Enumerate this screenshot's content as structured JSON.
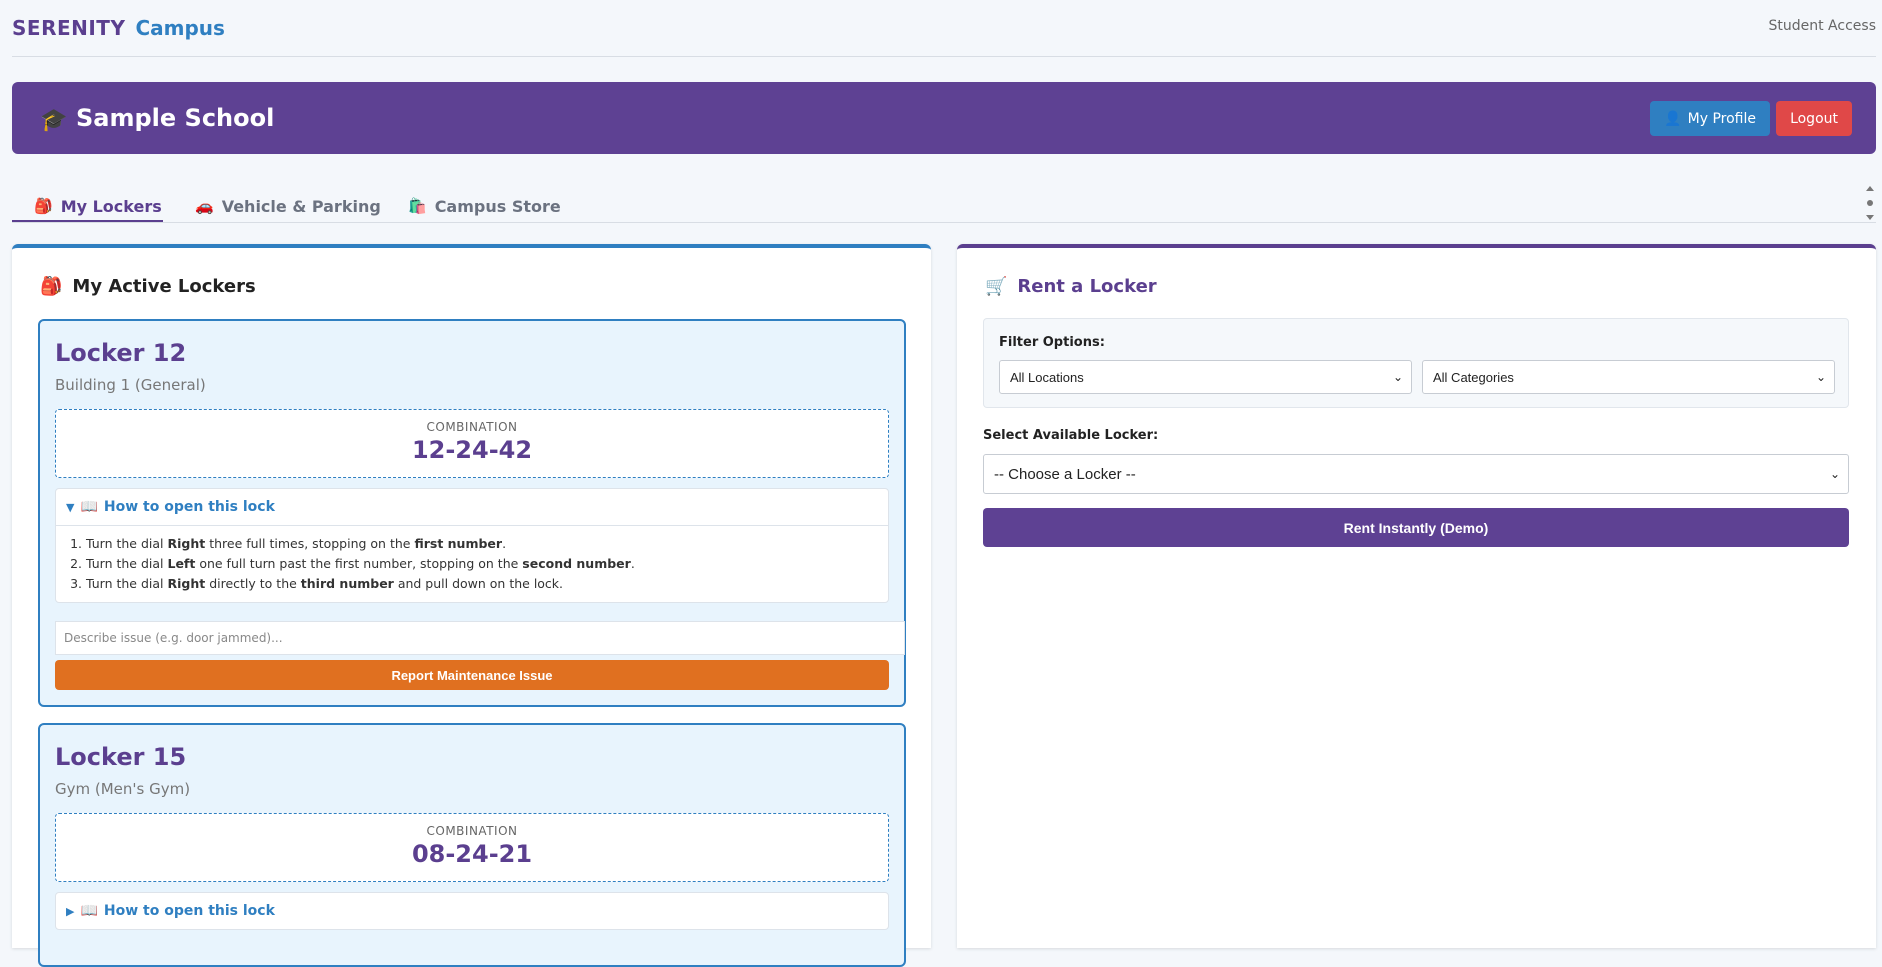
{
  "topbar": {
    "brand_a": "SERENITY",
    "brand_b": "Campus",
    "student_access": "Student Access"
  },
  "header": {
    "school_icon": "🎓",
    "school_name": "Sample School",
    "profile_icon": "👤",
    "profile_label": "My Profile",
    "logout_label": "Logout"
  },
  "tabs": [
    {
      "icon": "🎒",
      "label": "My Lockers"
    },
    {
      "icon": "🚗",
      "label": "Vehicle & Parking"
    },
    {
      "icon": "🛍️",
      "label": "Campus Store"
    }
  ],
  "lockers_panel": {
    "icon": "🎒",
    "title": "My Active Lockers",
    "howto_icon": "📖",
    "howto_label": "How to open this lock",
    "combo_label": "COMBINATION",
    "lockers": [
      {
        "title": "Locker 12",
        "location": "Building 1 (General)",
        "combination": "12-24-42",
        "expanded": true,
        "steps": [
          {
            "a": "Turn the dial ",
            "b": "Right",
            "c": " three full times, stopping on the ",
            "d": "first number",
            "e": "."
          },
          {
            "a": "Turn the dial ",
            "b": "Left",
            "c": " one full turn past the first number, stopping on the ",
            "d": "second number",
            "e": "."
          },
          {
            "a": "Turn the dial ",
            "b": "Right",
            "c": " directly to the ",
            "d": "third number",
            "e": " and pull down on the lock."
          }
        ],
        "issue_placeholder": "Describe issue (e.g. door jammed)...",
        "report_label": "Report Maintenance Issue"
      },
      {
        "title": "Locker 15",
        "location": "Gym (Men's Gym)",
        "combination": "08-24-21",
        "expanded": false
      }
    ],
    "arrow_down": "▼",
    "arrow_right": "▶"
  },
  "rent_panel": {
    "icon": "🛒",
    "title": "Rent a Locker",
    "filter_label": "Filter Options:",
    "location_value": "All Locations",
    "category_value": "All Categories",
    "select_label": "Select Available Locker:",
    "locker_select_value": "-- Choose a Locker --",
    "rent_label": "Rent Instantly (Demo)"
  },
  "colors": {
    "brand_purple": "#5e4193",
    "brand_blue": "#2f7fc1",
    "danger": "#e04848",
    "warning": "#e07020"
  }
}
